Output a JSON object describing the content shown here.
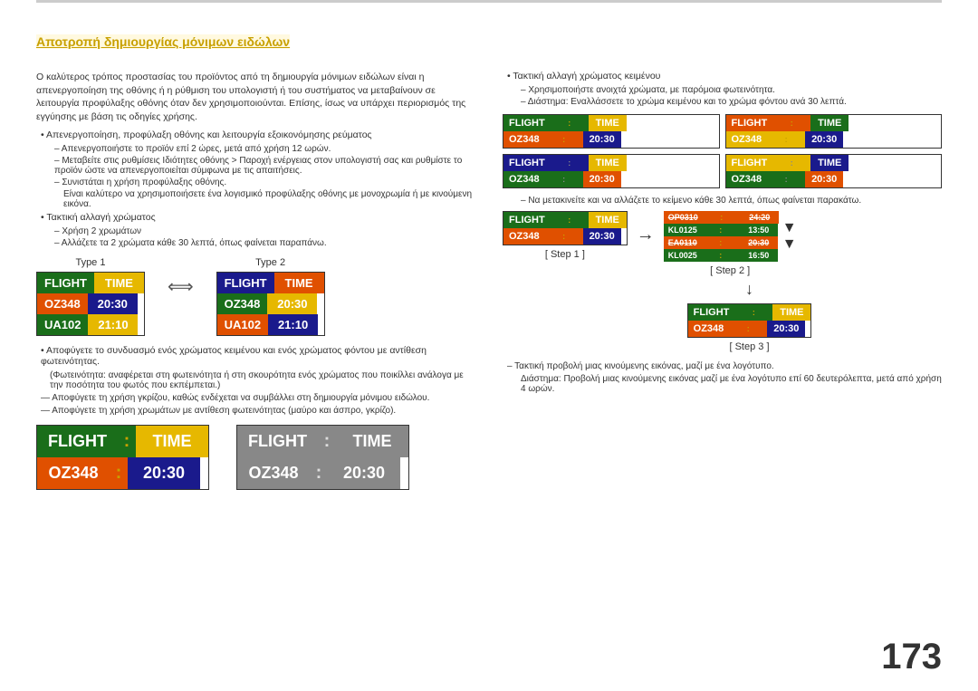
{
  "page": {
    "number": "173",
    "top_line_color": "#cccccc"
  },
  "section_title": "Αποτροπή δημιουργίας μόνιμων ειδώλων",
  "left_col": {
    "intro": "Ο καλύτερος τρόπος προστασίας του προϊόντος από τη δημιουργία μόνιμων ειδώλων είναι η απενεργοποίηση της οθόνης ή η ρύθμιση του υπολογιστή ή του συστήματος να μεταβαίνουν σε λειτουργία προφύλαξης οθόνης όταν δεν χρησιμοποιούνται. Επίσης, ίσως να υπάρχει περιορισμός της εγγύησης με βάση τις οδηγίες χρήσης.",
    "bullet1": "Απενεργοποίηση, προφύλαξη οθόνης και λειτουργία εξοικονόμησης ρεύματος",
    "sub1_1": "Απενεργοποιήστε το προϊόν επί 2 ώρες, μετά από χρήση 12 ωρών.",
    "sub1_2": "Μεταβείτε στις ρυθμίσεις Ιδιότητες οθόνης > Παροχή ενέργειας στον υπολογιστή σας και ρυθμίστε το προϊόν ώστε να απενεργοποιείται σύμφωνα με τις απαιτήσεις.",
    "sub1_3": "Συνιστάται η χρήση προφύλαξης οθόνης.",
    "sub1_3b": "Είναι καλύτερο να χρησιμοποιήσετε ένα λογισμικό προφύλαξης οθόνης με μονοχρωμία ή με κινούμενη εικόνα.",
    "bullet2": "Τακτική αλλαγή χρώματος",
    "sub2_1": "Χρήση 2 χρωμάτων",
    "sub2_2": "Αλλάζετε τα 2 χρώματα κάθε 30 λεπτά, όπως φαίνεται παραπάνω.",
    "type1_label": "Type 1",
    "type2_label": "Type 2",
    "flight_label": "FLIGHT",
    "time_label": "TIME",
    "colon": ":",
    "oz348": "OZ348",
    "time1": "20:30",
    "ua102": "UA102",
    "time2": "21:10",
    "bullet3": "Αποφύγετε το συνδυασμό ενός χρώματος κειμένου και ενός χρώματος φόντου με αντίθεση φωτεινότητας.",
    "sub3_1": "(Φωτεινότητα: αναφέρεται στη φωτεινότητα ή στη σκουρότητα ενός χρώματος που ποικίλλει ανάλογα με την ποσότητα του φωτός που εκπέμπεται.)",
    "dash1": "Αποφύγετε τη χρήση γκρίζου, καθώς ενδέχεται να συμβάλλει στη δημιουργία μόνιμου ειδώλου.",
    "dash2": "Αποφύγετε τη χρήση χρωμάτων με αντίθεση φωτεινότητας (μαύρο και άσπρο, γκρίζο)."
  },
  "right_col": {
    "bullet_color": "Τακτική αλλαγή χρώματος κειμένου",
    "sub_color1": "Χρησιμοποιήστε ανοιχτά χρώματα, με παρόμοια φωτεινότητα.",
    "sub_color2": "Διάστημα: Εναλλάσσετε το χρώμα κειμένου και το χρώμα φόντου ανά 30 λεπτά.",
    "grid_tables": [
      {
        "header_l": "FLIGHT",
        "colon": ":",
        "header_r": "TIME",
        "data_l": "OZ348",
        "data_colon": ":",
        "data_r": "20:30",
        "hl": "#1a6e1a",
        "hr": "#e6b800",
        "dl": "#e05000",
        "dr": "#1a1a8c"
      },
      {
        "header_l": "FLIGHT",
        "colon": ":",
        "header_r": "TIME",
        "data_l": "OZ348",
        "data_colon": ":",
        "data_r": "20:30",
        "hl": "#e05000",
        "hr": "#1a1a8c",
        "dl": "#1a6e1a",
        "hr2": "#e05000",
        "dl2": "#e6b800",
        "dr": "#1a6e1a"
      },
      {
        "header_l": "FLIGHT",
        "colon": ":",
        "header_r": "TIME",
        "data_l": "OZ348",
        "data_colon": ":",
        "data_r": "20:30",
        "hl": "#1a1a8c",
        "hr": "#e6b800",
        "dl": "#e05000",
        "dr": "#1a6e1a"
      },
      {
        "header_l": "FLIGHT",
        "colon": ":",
        "header_r": "TIME",
        "data_l": "OZ348",
        "data_colon": ":",
        "data_r": "20:30",
        "hl": "#e6b800",
        "hr": "#1a1a8c",
        "dl": "#1a6e1a",
        "dr": "#e05000"
      }
    ],
    "step_intro": "Να μετακινείτε και να αλλάζετε το κείμενο κάθε 30 λεπτά, όπως φαίνεται παρακάτω.",
    "step1_label": "[ Step 1 ]",
    "step2_label": "[ Step 2 ]",
    "step3_label": "[ Step 3 ]",
    "step1_flight": "FLIGHT",
    "step1_time": "TIME",
    "step1_oz": "OZ348",
    "step1_t": "20:30",
    "step2_lines": [
      "OP0310 : 24:20",
      "KL0125 : 13:50",
      "EA0110 : 20:30",
      "KL0025 : 16:50"
    ],
    "dash_moving": "Τακτική προβολή μιας κινούμενης εικόνας, μαζί με ένα λογότυπο.",
    "sub_moving": "Διάστημα: Προβολή μιας κινούμενης εικόνας μαζί με ένα λογότυπο επί 60 δευτερόλεπτα, μετά από χρήση 4 ωρών."
  },
  "bottom": {
    "left_label": "",
    "right_label": "",
    "left_flight": "FLIGHT",
    "left_colon": ":",
    "left_time": "TIME",
    "left_oz": "OZ348",
    "left_dc": ":",
    "left_t": "20:30",
    "right_flight": "FLIGHT",
    "right_colon": ":",
    "right_time": "TIME",
    "right_oz": "OZ348",
    "right_dc": ":",
    "right_t": "20:30"
  }
}
